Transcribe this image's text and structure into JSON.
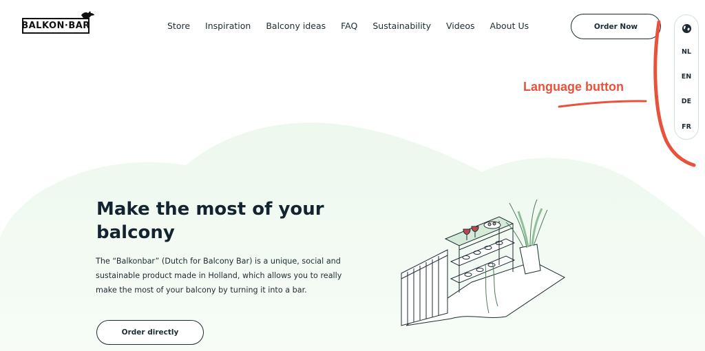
{
  "brand": {
    "logo_text": "BALKON·BAR"
  },
  "nav": {
    "items": [
      {
        "label": "Store"
      },
      {
        "label": "Inspiration"
      },
      {
        "label": "Balcony ideas"
      },
      {
        "label": "FAQ"
      },
      {
        "label": "Sustainability"
      },
      {
        "label": "Videos"
      },
      {
        "label": "About Us"
      }
    ]
  },
  "header": {
    "order_now_label": "Order Now"
  },
  "language": {
    "icon": "globe-icon",
    "options": [
      "NL",
      "EN",
      "DE",
      "FR"
    ]
  },
  "annotation": {
    "label": "Language button",
    "color": "#e8523a"
  },
  "hero": {
    "title": "Make the most of your balcony",
    "description": "The “Balkonbar” (Dutch for Balcony Bar) is a unique, social and sustainable product made in Holland, which allows you to really make the most of your balcony by turning it into a bar.",
    "cta_label": "Order directly"
  },
  "colors": {
    "accent_green": "#e9f6ea",
    "text_dark": "#122430",
    "annotation_red": "#e8523a"
  }
}
